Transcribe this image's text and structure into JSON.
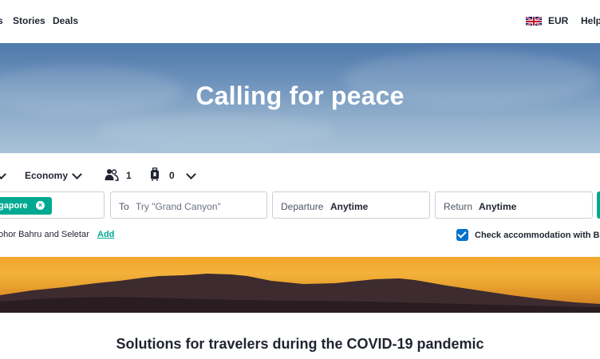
{
  "nav": {
    "cut_item": "s",
    "stories": "Stories",
    "deals": "Deals",
    "currency": "EUR",
    "help": "Help"
  },
  "hero": {
    "title": "Calling for peace"
  },
  "search": {
    "cabin_class": "Economy",
    "passengers": "1",
    "bags": "0",
    "origin_chip": "gapore",
    "to_label": "To",
    "to_placeholder": "Try \"Grand Canyon\"",
    "departure_label": "Departure",
    "departure_value": "Anytime",
    "return_label": "Return",
    "return_value": "Anytime",
    "nearby_text": "ohor Bahru and Seletar",
    "add_label": "Add",
    "accommodation_checked": true,
    "accommodation_label": "Check accommodation with B"
  },
  "section": {
    "title": "Solutions for travelers during the COVID-19 pandemic"
  },
  "colors": {
    "brand_green": "#00a991",
    "checkbox_blue": "#0172cb",
    "text_dark": "#1f2430"
  },
  "icons": {
    "flag": "uk-flag-icon",
    "passengers": "passengers-icon",
    "bags": "bag-icon",
    "chip_remove": "close-circle-icon",
    "checkbox": "checkmark-icon"
  }
}
